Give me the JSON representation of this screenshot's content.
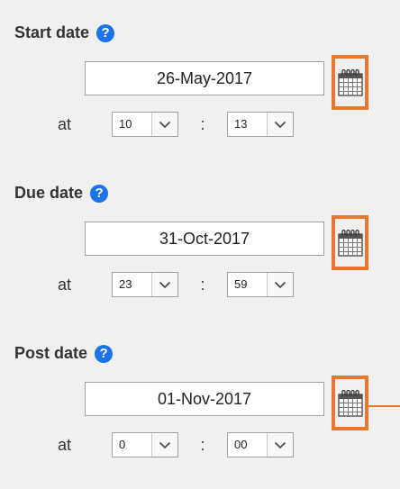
{
  "sections": [
    {
      "label": "Start date",
      "help_icon": "question-circle-icon",
      "date_value": "26-May-2017",
      "at_label": "at",
      "hour": "10",
      "separator": ":",
      "minute": "13",
      "calendar_icon": "calendar-icon"
    },
    {
      "label": "Due date",
      "help_icon": "question-circle-icon",
      "date_value": "31-Oct-2017",
      "at_label": "at",
      "hour": "23",
      "separator": ":",
      "minute": "59",
      "calendar_icon": "calendar-icon"
    },
    {
      "label": "Post date",
      "help_icon": "question-circle-icon",
      "date_value": "01-Nov-2017",
      "at_label": "at",
      "hour": "0",
      "separator": ":",
      "minute": "00",
      "calendar_icon": "calendar-icon"
    }
  ],
  "help_glyph": "?",
  "colors": {
    "panel_background": "#f0f0f0",
    "help_icon": "#1a73e8",
    "highlight_border": "#e8792c",
    "label_text": "#333333"
  }
}
